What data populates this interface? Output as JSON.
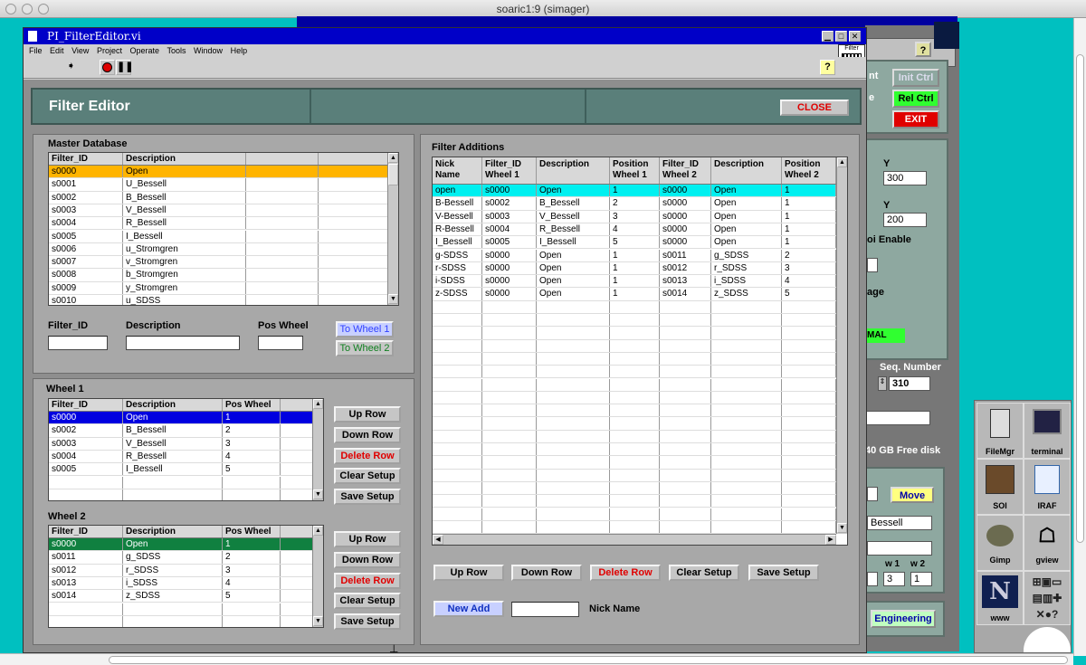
{
  "mac_window_title": "soaric1:9 (simager)",
  "window": {
    "title": "PI_FilterEditor.vi",
    "menu": [
      "File",
      "Edit",
      "View",
      "Project",
      "Operate",
      "Tools",
      "Window",
      "Help"
    ],
    "filter_icon_label": "Filter",
    "help_glyph": "?"
  },
  "header": {
    "title": "Filter Editor",
    "close_label": "CLOSE"
  },
  "master": {
    "label": "Master Database",
    "columns": [
      "Filter_ID",
      "Description",
      "",
      ""
    ],
    "rows": [
      [
        "s0000",
        "Open"
      ],
      [
        "s0001",
        "U_Bessell"
      ],
      [
        "s0002",
        "B_Bessell"
      ],
      [
        "s0003",
        "V_Bessell"
      ],
      [
        "s0004",
        "R_Bessell"
      ],
      [
        "s0005",
        "I_Bessell"
      ],
      [
        "s0006",
        "u_Stromgren"
      ],
      [
        "s0007",
        "v_Stromgren"
      ],
      [
        "s0008",
        "b_Stromgren"
      ],
      [
        "s0009",
        "y_Stromgren"
      ],
      [
        "s0010",
        "u_SDSS"
      ]
    ],
    "selected_color": "#ffb400",
    "filter_id_label": "Filter_ID",
    "description_label": "Description",
    "pos_wheel_label": "Pos Wheel",
    "to_wheel1": "To Wheel 1",
    "to_wheel2": "To Wheel 2"
  },
  "wheel1": {
    "label": "Wheel 1",
    "columns": [
      "Filter_ID",
      "Description",
      "Pos Wheel",
      ""
    ],
    "rows": [
      [
        "s0000",
        "Open",
        "1"
      ],
      [
        "s0002",
        "B_Bessell",
        "2"
      ],
      [
        "s0003",
        "V_Bessell",
        "3"
      ],
      [
        "s0004",
        "R_Bessell",
        "4"
      ],
      [
        "s0005",
        "I_Bessell",
        "5"
      ]
    ],
    "selected_color": "#0000e0"
  },
  "wheel2": {
    "label": "Wheel 2",
    "columns": [
      "Filter_ID",
      "Description",
      "Pos Wheel",
      ""
    ],
    "rows": [
      [
        "s0000",
        "Open",
        "1"
      ],
      [
        "s0011",
        "g_SDSS",
        "2"
      ],
      [
        "s0012",
        "r_SDSS",
        "3"
      ],
      [
        "s0013",
        "i_SDSS",
        "4"
      ],
      [
        "s0014",
        "z_SDSS",
        "5"
      ]
    ],
    "selected_color": "#108040"
  },
  "row_buttons": {
    "up": "Up Row",
    "down": "Down Row",
    "delete": "Delete Row",
    "clear": "Clear Setup",
    "save": "Save Setup"
  },
  "additions": {
    "label": "Filter Additions",
    "columns": [
      "Nick Name",
      "Filter_ID Wheel 1",
      "Description",
      "Position Wheel 1",
      "Filter_ID Wheel 2",
      "Description",
      "Position Wheel 2"
    ],
    "rows": [
      [
        "open",
        "s0000",
        "Open",
        "1",
        "s0000",
        "Open",
        "1"
      ],
      [
        "B-Bessell",
        "s0002",
        "B_Bessell",
        "2",
        "s0000",
        "Open",
        "1"
      ],
      [
        "V-Bessell",
        "s0003",
        "V_Bessell",
        "3",
        "s0000",
        "Open",
        "1"
      ],
      [
        "R-Bessell",
        "s0004",
        "R_Bessell",
        "4",
        "s0000",
        "Open",
        "1"
      ],
      [
        "I_Bessell",
        "s0005",
        "I_Bessell",
        "5",
        "s0000",
        "Open",
        "1"
      ],
      [
        "g-SDSS",
        "s0000",
        "Open",
        "1",
        "s0011",
        "g_SDSS",
        "2"
      ],
      [
        "r-SDSS",
        "s0000",
        "Open",
        "1",
        "s0012",
        "r_SDSS",
        "3"
      ],
      [
        "i-SDSS",
        "s0000",
        "Open",
        "1",
        "s0013",
        "i_SDSS",
        "4"
      ],
      [
        "z-SDSS",
        "s0000",
        "Open",
        "1",
        "s0014",
        "z_SDSS",
        "5"
      ]
    ],
    "selected_color": "#00f0f0",
    "new_add": "New Add",
    "nick_name_label": "Nick Name"
  },
  "background_panel": {
    "init_ctrl": "Init Ctrl",
    "rel_ctrl": "Rel Ctrl",
    "exit": "EXIT",
    "label_nt": "nt",
    "label_e": "e",
    "y1_label": "Y",
    "y1_value": "300",
    "y2_label": "Y",
    "y2_value": "200",
    "pi_enable": "oi Enable",
    "age": "age",
    "mal": "MAL",
    "seq_label": "Seq. Number",
    "seq_value": "310",
    "free_disk": "40 GB Free disk",
    "move": "Move",
    "bessell": "Bessell",
    "w1_label": "w 1",
    "w2_label": "w 2",
    "w1_value": "3",
    "w2_value": "1",
    "engineering": "Engineering"
  },
  "dock": {
    "filemgr": "FileMgr",
    "terminal": "terminal",
    "soi": "SOI",
    "iraf": "IRAF",
    "gimp": "Gimp",
    "gview": "gview",
    "www": "www"
  }
}
